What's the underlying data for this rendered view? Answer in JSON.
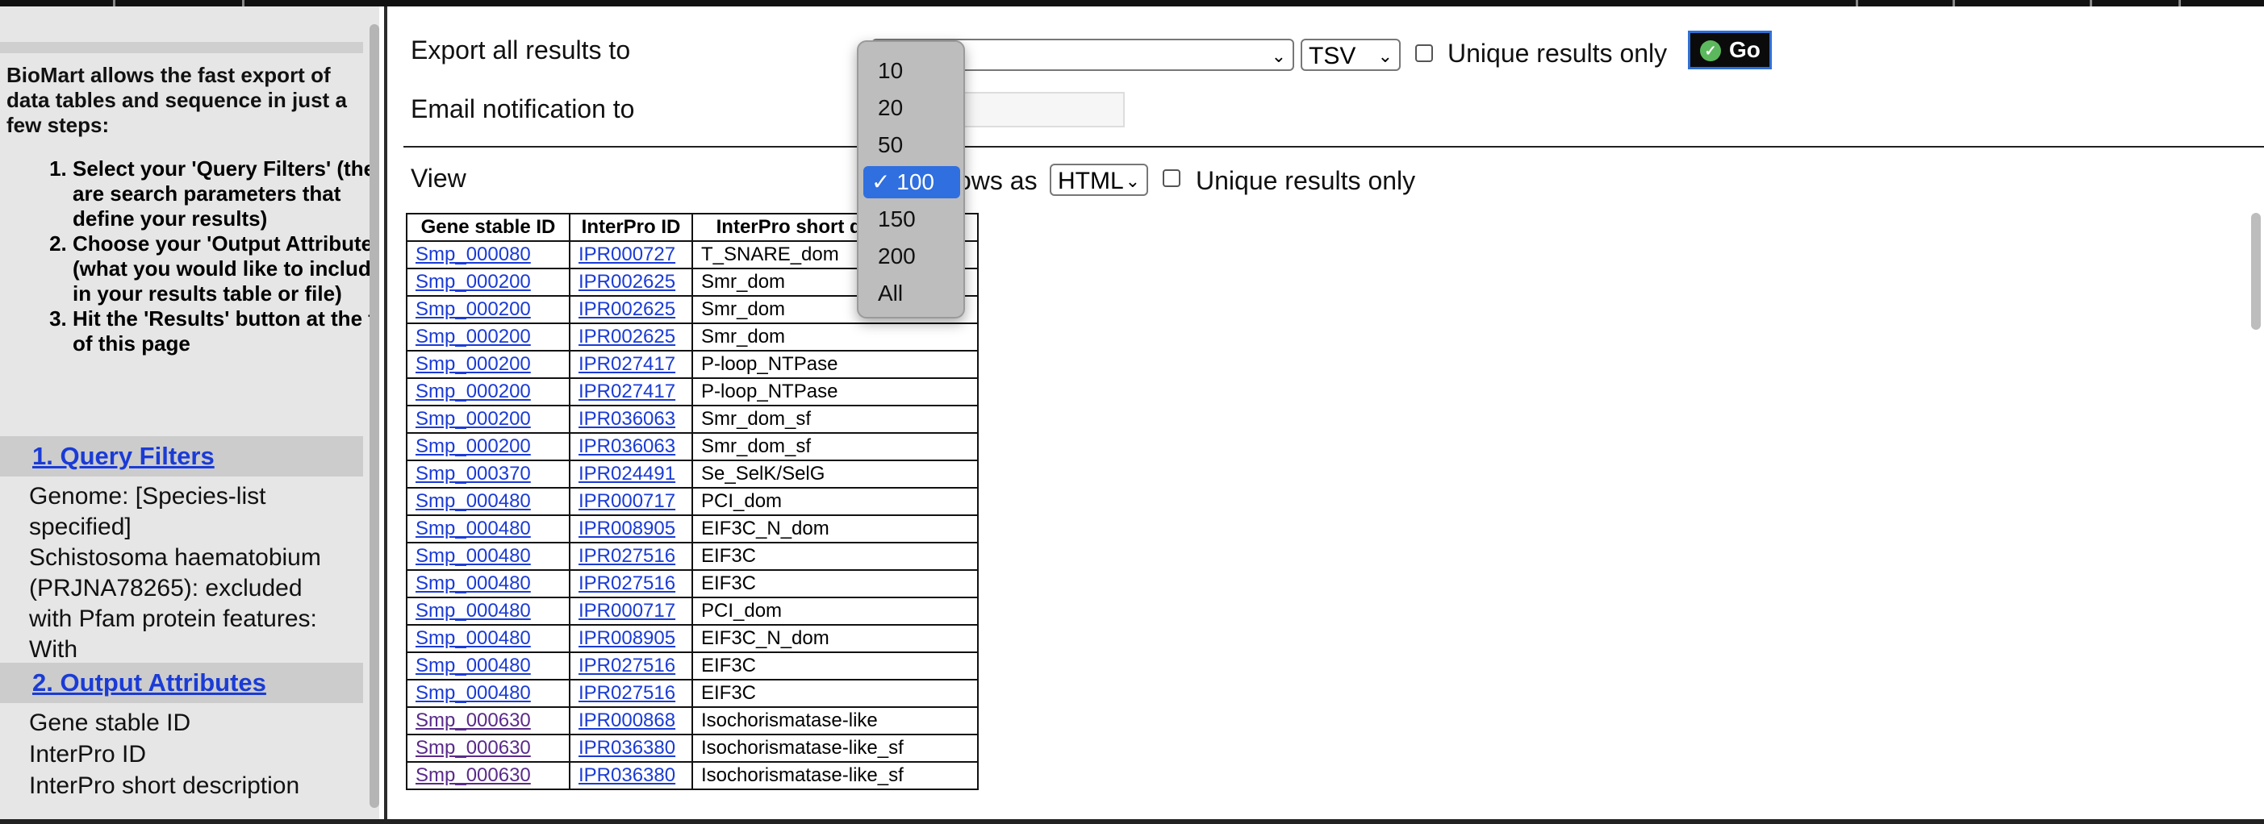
{
  "sidebar": {
    "intro": "BioMart allows the fast export of data tables and sequence in just a few steps:",
    "steps": [
      "Select your 'Query Filters' (these are search parameters that define your results)",
      "Choose your 'Output Attributes' (what you would like to include in your results table or file)",
      "Hit the 'Results' button at the top of this page"
    ],
    "query_filters": {
      "heading": "1. Query Filters",
      "genome": "Genome: [Species-list specified]",
      "exclusion": "Schistosoma haematobium (PRJNA78265): excluded",
      "pfam": "with Pfam protein features: With"
    },
    "output_attributes": {
      "heading": "2. Output Attributes",
      "items": [
        "Gene stable ID",
        "InterPro ID",
        "InterPro short description"
      ]
    }
  },
  "export": {
    "label": "Export all results to",
    "format_value": "TSV",
    "unique_label": "Unique results only",
    "go_label": "Go"
  },
  "email": {
    "label": "Email notification to"
  },
  "view": {
    "label": "View",
    "rows_as_fragment": "ows as",
    "format_value": "HTML",
    "unique_label": "Unique results only"
  },
  "row_count_dropdown": {
    "options": [
      "10",
      "20",
      "50",
      "100",
      "150",
      "200",
      "All"
    ],
    "selected": "100",
    "check_mark": "✓"
  },
  "table": {
    "headers": [
      "Gene stable ID",
      "InterPro ID",
      "InterPro short description"
    ],
    "rows": [
      [
        "Smp_000080",
        "IPR000727",
        "T_SNARE_dom"
      ],
      [
        "Smp_000200",
        "IPR002625",
        "Smr_dom"
      ],
      [
        "Smp_000200",
        "IPR002625",
        "Smr_dom"
      ],
      [
        "Smp_000200",
        "IPR002625",
        "Smr_dom"
      ],
      [
        "Smp_000200",
        "IPR027417",
        "P-loop_NTPase"
      ],
      [
        "Smp_000200",
        "IPR027417",
        "P-loop_NTPase"
      ],
      [
        "Smp_000200",
        "IPR036063",
        "Smr_dom_sf"
      ],
      [
        "Smp_000200",
        "IPR036063",
        "Smr_dom_sf"
      ],
      [
        "Smp_000370",
        "IPR024491",
        "Se_SelK/SelG"
      ],
      [
        "Smp_000480",
        "IPR000717",
        "PCI_dom"
      ],
      [
        "Smp_000480",
        "IPR008905",
        "EIF3C_N_dom"
      ],
      [
        "Smp_000480",
        "IPR027516",
        "EIF3C"
      ],
      [
        "Smp_000480",
        "IPR027516",
        "EIF3C"
      ],
      [
        "Smp_000480",
        "IPR000717",
        "PCI_dom"
      ],
      [
        "Smp_000480",
        "IPR008905",
        "EIF3C_N_dom"
      ],
      [
        "Smp_000480",
        "IPR027516",
        "EIF3C"
      ],
      [
        "Smp_000480",
        "IPR027516",
        "EIF3C"
      ],
      [
        "Smp_000630",
        "IPR000868",
        "Isochorismatase-like"
      ],
      [
        "Smp_000630",
        "IPR036380",
        "Isochorismatase-like_sf"
      ],
      [
        "Smp_000630",
        "IPR036380",
        "Isochorismatase-like_sf"
      ]
    ],
    "visited_gene": "Smp_000630"
  }
}
